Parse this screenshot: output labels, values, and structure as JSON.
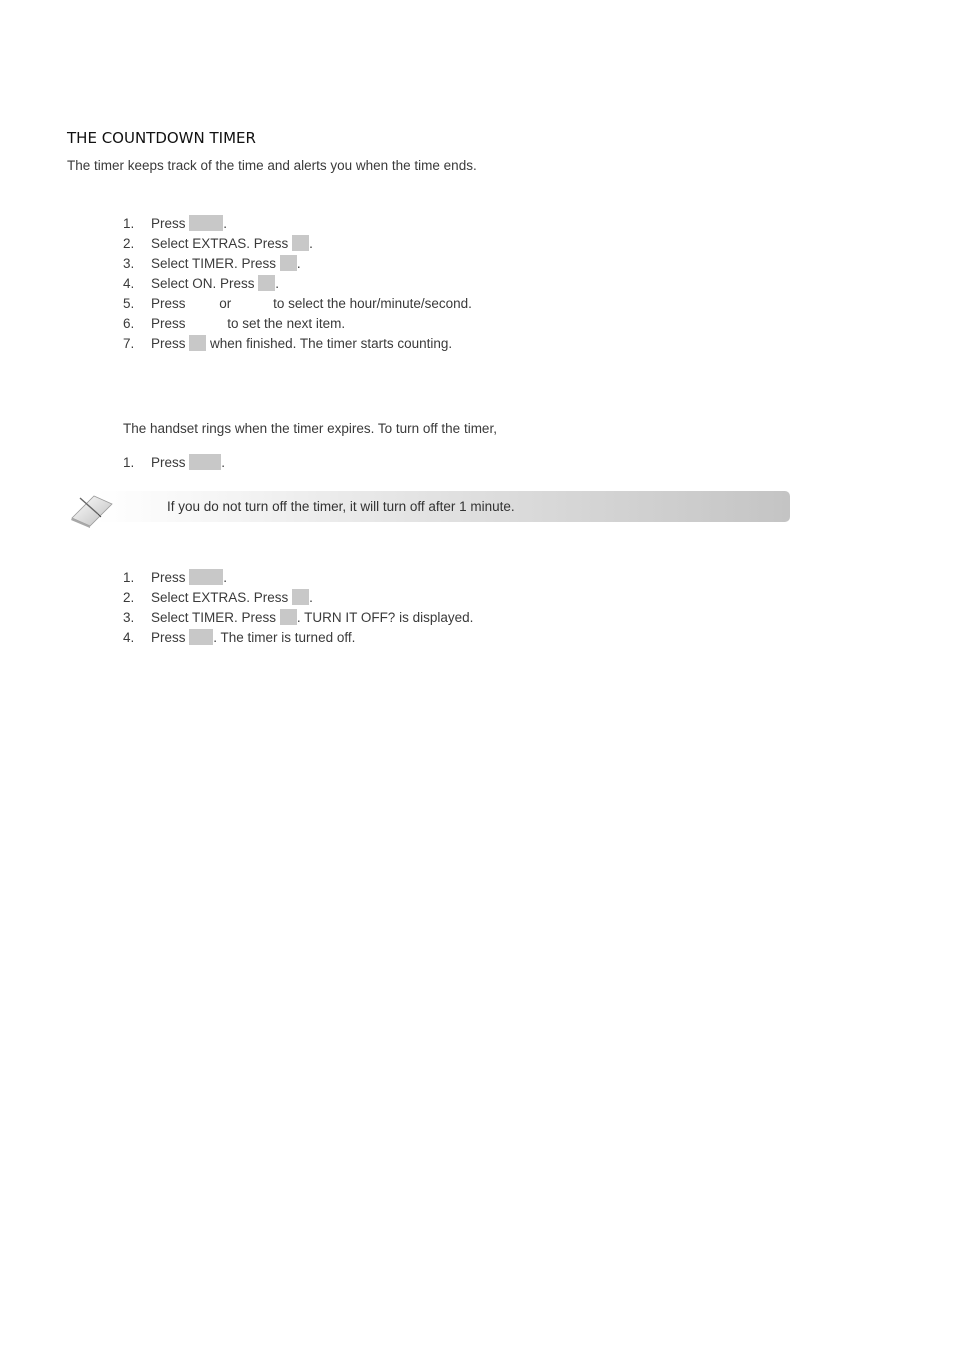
{
  "section": {
    "title": "THE COUNTDOWN TIMER",
    "intro": "The timer keeps track of the time and alerts you when the time ends."
  },
  "set_timer": {
    "steps": [
      {
        "num": "1.",
        "before": "Press",
        "key": "menu-key",
        "after": "."
      },
      {
        "num": "2.",
        "before": "Select EXTRAS. Press",
        "key": "ok-key",
        "after": "."
      },
      {
        "num": "3.",
        "before": "Select TIMER. Press",
        "key": "ok-key",
        "after": "."
      },
      {
        "num": "4.",
        "before": "Select ON. Press",
        "key": "ok-key",
        "after": "."
      },
      {
        "num": "5.",
        "before": "Press",
        "middle": "or",
        "after": "to select the hour/minute/second."
      },
      {
        "num": "6.",
        "before": "Press",
        "after": "to set the next item."
      },
      {
        "num": "7.",
        "before": "Press",
        "key": "ok-key",
        "after": "when finished. The timer starts counting."
      }
    ]
  },
  "expire": {
    "paragraph": "The handset rings when the timer expires. To turn off the timer,",
    "steps": [
      {
        "num": "1.",
        "before": "Press",
        "key": "any-key",
        "after": "."
      }
    ]
  },
  "note": {
    "icon": "note-pad-icon",
    "text": "If you do not turn off the timer, it will turn off after 1 minute."
  },
  "turn_off": {
    "steps": [
      {
        "num": "1.",
        "before": "Press",
        "key": "menu-key",
        "after": "."
      },
      {
        "num": "2.",
        "before": "Select EXTRAS. Press",
        "key": "ok-key",
        "after": "."
      },
      {
        "num": "3.",
        "before": "Select TIMER. Press",
        "key": "ok-key",
        "after": ". TURN IT OFF? is displayed."
      },
      {
        "num": "4.",
        "before": "Press",
        "key": "ok-key",
        "after": ". The timer is turned off."
      }
    ]
  },
  "colors": {
    "key_placeholder": "#c8c8c8",
    "text": "#3a3a3a",
    "title": "#111111"
  }
}
